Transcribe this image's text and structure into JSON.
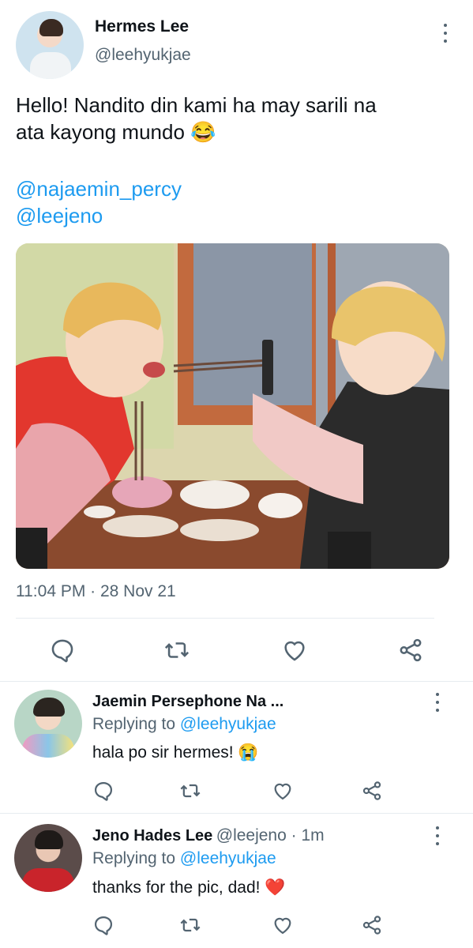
{
  "tweet": {
    "author_name": "Hermes Lee",
    "author_handle": "@leehyukjae",
    "text_line1": "Hello! Nandito din kami ha may sarili na",
    "text_line2": "ata kayong mundo",
    "emoji": "😂",
    "mention1": "@najaemin_percy",
    "mention2": "@leejeno",
    "timestamp": "11:04 PM · 28 Nov 21"
  },
  "replies": [
    {
      "name": "Jaemin Persephone Na ...",
      "handle_time": "",
      "replying_label": "Replying to ",
      "replying_to": "@leehyukjae",
      "text": "hala po sir hermes! ",
      "emoji": "😭"
    },
    {
      "name": "Jeno Hades Lee",
      "handle_time": "@leejeno · 1m",
      "replying_label": "Replying to ",
      "replying_to": "@leehyukjae",
      "text": "thanks for the pic, dad! ",
      "emoji": "❤️"
    }
  ],
  "icons": [
    "more-vert-icon",
    "reply-icon",
    "retweet-icon",
    "like-icon",
    "share-icon"
  ],
  "colors": {
    "link": "#1d9bf0",
    "secondary": "#536471",
    "divider": "#e6ecf0"
  }
}
